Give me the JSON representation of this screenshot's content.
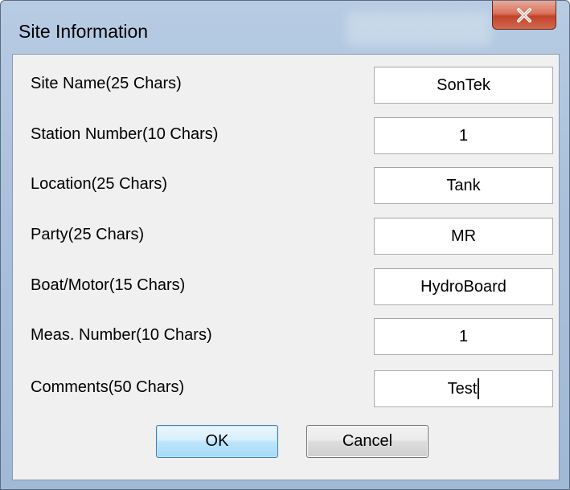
{
  "window": {
    "title": "Site Information",
    "close_symbol": "X"
  },
  "fields": [
    {
      "label": "Site Name(25 Chars)",
      "value": "SonTek"
    },
    {
      "label": "Station Number(10 Chars)",
      "value": "1"
    },
    {
      "label": "Location(25 Chars)",
      "value": "Tank"
    },
    {
      "label": "Party(25 Chars)",
      "value": "MR"
    },
    {
      "label": "Boat/Motor(15 Chars)",
      "value": "HydroBoard"
    },
    {
      "label": "Meas. Number(10 Chars)",
      "value": "1"
    },
    {
      "label": "Comments(50 Chars)",
      "value": "Test"
    }
  ],
  "buttons": {
    "ok": "OK",
    "cancel": "Cancel"
  },
  "icons": {
    "close": "close-icon"
  },
  "colors": {
    "frame": "#a9c1dc",
    "close_button": "#c2432a",
    "ok_button_border": "#3c7fb1",
    "client_background": "#f0f0f0"
  }
}
